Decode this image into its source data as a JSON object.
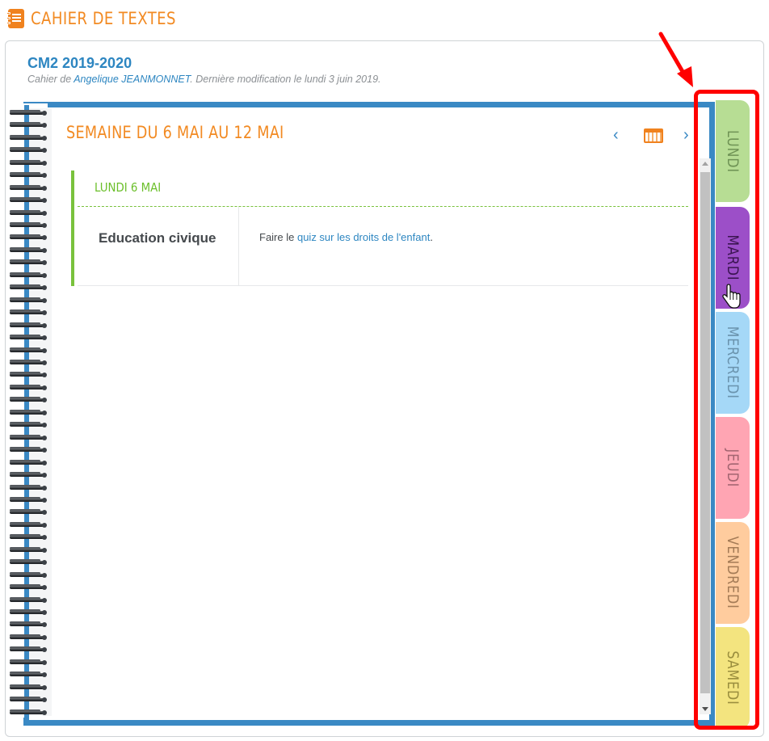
{
  "app": {
    "title": "CAHIER DE TEXTES",
    "accent_color": "#f28a22"
  },
  "card": {
    "class_title": "CM2 2019-2020",
    "subtitle_prefix": "Cahier de ",
    "author": "Angelique JEANMONNET",
    "subtitle_suffix": ". Dernière modification le lundi 3 juin 2019."
  },
  "week": {
    "title": "SEMAINE DU 6 MAI AU 12 MAI",
    "prev_icon": "‹",
    "next_icon": "›",
    "calendar_icon": "calendar-icon"
  },
  "day": {
    "title": "LUNDI 6 MAI",
    "entries": [
      {
        "subject": "Education civique",
        "text_before": "Faire le ",
        "link_text": "quiz sur les droits de l'enfant",
        "text_after": "."
      }
    ]
  },
  "tabs": [
    {
      "label": "LUNDI",
      "color": "#b7dd94"
    },
    {
      "label": "MARDI",
      "color": "#9c4fc8"
    },
    {
      "label": "MERCREDI",
      "color": "#a5d8f7"
    },
    {
      "label": "JEUDI",
      "color": "#ffa5b3"
    },
    {
      "label": "VENDREDI",
      "color": "#ffcc9e"
    },
    {
      "label": "SAMEDI",
      "color": "#f3e47f"
    }
  ],
  "annotation": {
    "highlight_color": "#ff0000"
  }
}
